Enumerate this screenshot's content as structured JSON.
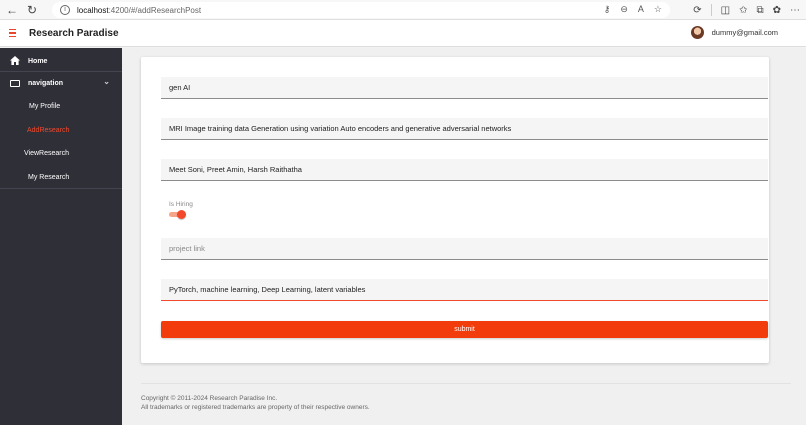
{
  "browser": {
    "url_host": "localhost",
    "url_path": ":4200/#/addResearchPost"
  },
  "header": {
    "brand": "Research Paradise",
    "user_email": "dummy@gmail.com"
  },
  "sidebar": {
    "home": "Home",
    "navigation": "navigation",
    "items": [
      {
        "label": "My Profile"
      },
      {
        "label": "AddResearch"
      },
      {
        "label": "ViewResearch"
      },
      {
        "label": "My Research"
      }
    ]
  },
  "form": {
    "field1": "gen AI",
    "field2": "MRI Image training data Generation using variation Auto encoders and generative adversarial networks",
    "field3": "Meet Soni, Preet Amin, Harsh Raithatha",
    "hiring_label": "Is Hiring",
    "hiring_on": true,
    "project_link_placeholder": "project link",
    "tags": "PyTorch, machine learning, Deep Learning, latent variables",
    "submit": "submit"
  },
  "footer": {
    "line1": "Copyright © 2011-2024 Research Paradise Inc.",
    "line2": "All trademarks or registered trademarks are property of their respective owners."
  },
  "colors": {
    "accent": "#f2492c",
    "sidebar_bg": "#2f2f38",
    "submit_bg": "#f23c0c"
  }
}
